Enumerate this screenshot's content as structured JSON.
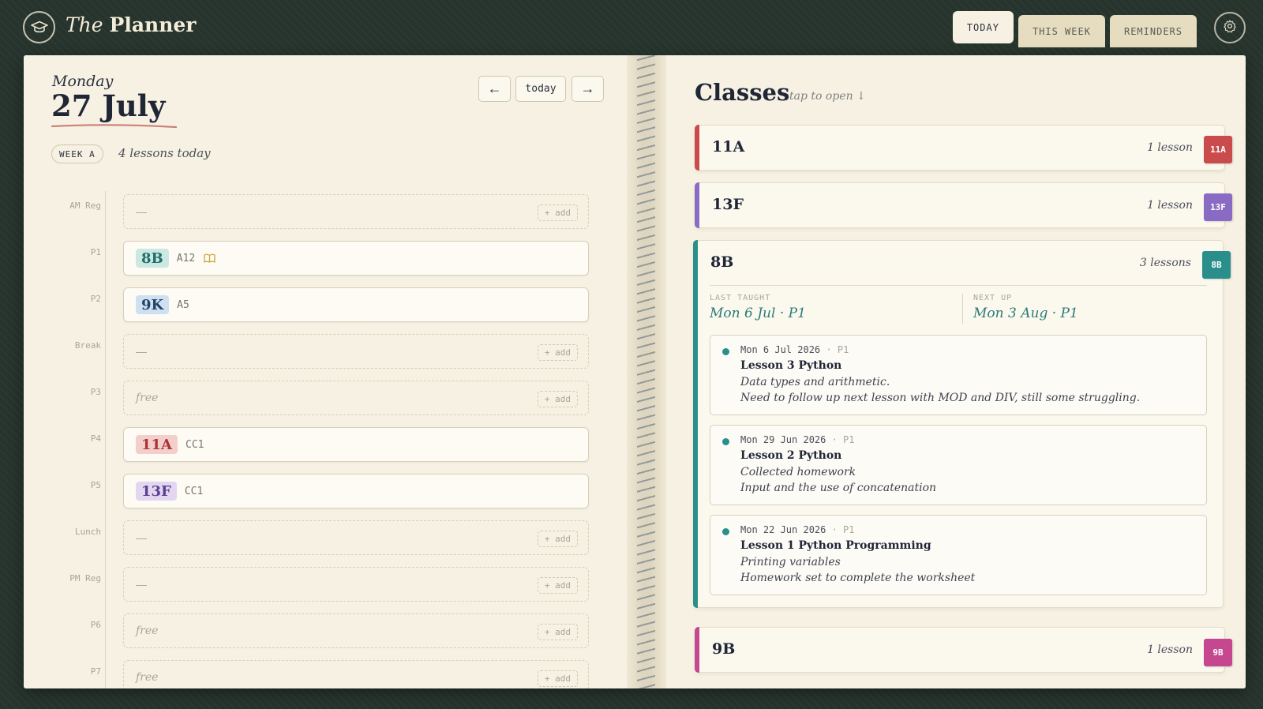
{
  "app": {
    "brand_italic": "The",
    "brand_bold": "Planner"
  },
  "tabs": [
    {
      "label": "TODAY",
      "active": true
    },
    {
      "label": "THIS WEEK",
      "active": false
    },
    {
      "label": "REMINDERS",
      "active": false
    }
  ],
  "icons": {
    "logo": "graduation-cap-icon",
    "settings": "gear-icon",
    "prev": "arrow-left-icon",
    "next": "arrow-right-icon",
    "plan": "book-icon",
    "collapse": "chevron-down-icon",
    "expand": "chevron-up-icon"
  },
  "colors": {
    "accent_teal": "#2a8f8a",
    "class_11A": "#c94b4b",
    "class_13F": "#8a6bc4",
    "class_8B": "#2a8f8a",
    "class_9B": "#c4478f"
  },
  "day": {
    "weekday": "Monday",
    "date": "27 July",
    "week": "WEEK A",
    "lessons_summary": "4 lessons today"
  },
  "nav": {
    "prev": "←",
    "today": "today",
    "next": "→"
  },
  "periods": [
    {
      "label": "AM Reg",
      "type": "empty",
      "text": "—",
      "add": "+ add"
    },
    {
      "label": "P1",
      "type": "lesson",
      "class": "8B",
      "room": "A12",
      "has_plan": true
    },
    {
      "label": "P2",
      "type": "lesson",
      "class": "9K",
      "room": "A5"
    },
    {
      "label": "Break",
      "type": "empty",
      "text": "—",
      "add": "+ add"
    },
    {
      "label": "P3",
      "type": "free",
      "text": "free",
      "add": "+ add"
    },
    {
      "label": "P4",
      "type": "lesson",
      "class": "11A",
      "room": "CC1"
    },
    {
      "label": "P5",
      "type": "lesson",
      "class": "13F",
      "room": "CC1"
    },
    {
      "label": "Lunch",
      "type": "empty",
      "text": "—",
      "add": "+ add"
    },
    {
      "label": "PM Reg",
      "type": "empty",
      "text": "—",
      "add": "+ add"
    },
    {
      "label": "P6",
      "type": "free",
      "text": "free",
      "add": "+ add"
    },
    {
      "label": "P7",
      "type": "free",
      "text": "free",
      "add": "+ add"
    }
  ],
  "classes": {
    "title": "Classes",
    "hint": "tap to open ↓",
    "cards": [
      {
        "name": "11A",
        "count": "1 lesson",
        "tag": "11A"
      },
      {
        "name": "13F",
        "count": "1 lesson",
        "tag": "13F"
      },
      {
        "name": "8B",
        "count": "3 lessons",
        "tag": "8B",
        "expanded": true,
        "last_taught_label": "LAST TAUGHT",
        "last_taught": "Mon 6 Jul · P1",
        "next_up_label": "NEXT UP",
        "next_up": "Mon 3 Aug · P1",
        "lessons": [
          {
            "date": "Mon 6 Jul 2026",
            "period": "· P1",
            "title": "Lesson 3 Python",
            "notes": [
              "Data types and arithmetic.",
              "Need to follow up next lesson with MOD and DIV, still some struggling."
            ]
          },
          {
            "date": "Mon 29 Jun 2026",
            "period": "· P1",
            "title": "Lesson 2 Python",
            "notes": [
              "Collected homework",
              "Input and the use of concatenation"
            ]
          },
          {
            "date": "Mon 22 Jun 2026",
            "period": "· P1",
            "title": "Lesson 1 Python Programming",
            "notes": [
              "Printing variables",
              "Homework set to complete the worksheet"
            ]
          }
        ]
      },
      {
        "name": "9B",
        "count": "1 lesson",
        "tag": "9B"
      }
    ]
  }
}
